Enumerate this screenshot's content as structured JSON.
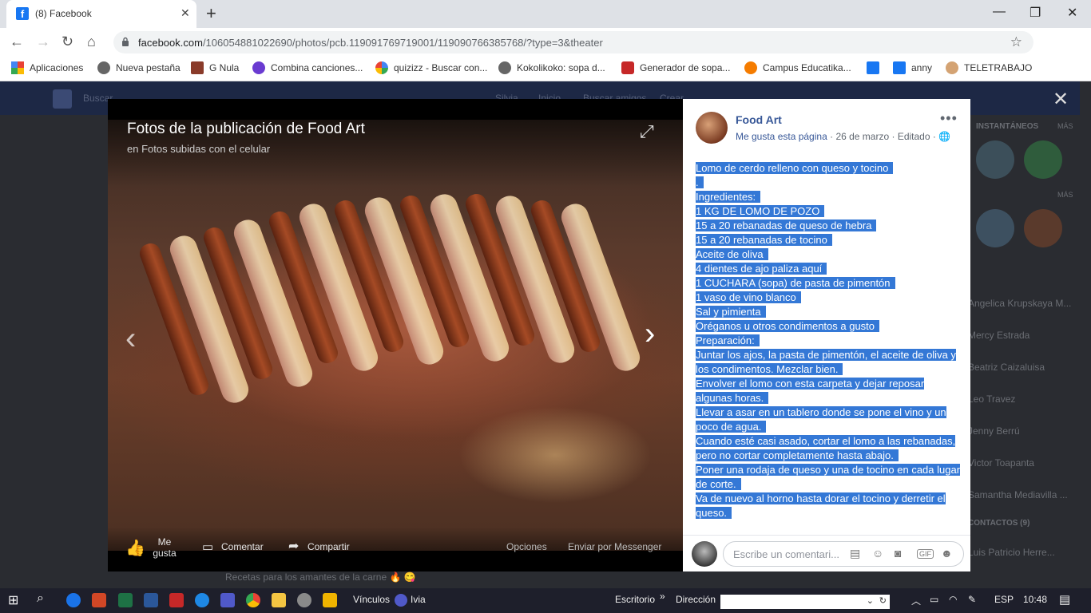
{
  "browser": {
    "tab_title": "(8) Facebook",
    "tab_icon": "facebook-icon",
    "url_domain": "facebook.com",
    "url_path": "/106054881022690/photos/pcb.119091769719001/119090766385768/?type=3&theater"
  },
  "bookmarks": [
    {
      "label": "Aplicaciones",
      "icon": "apps-grid-icon",
      "color": "#e94235"
    },
    {
      "label": "Nueva pestaña",
      "icon": "globe-icon",
      "color": "#555555"
    },
    {
      "label": "G Nula",
      "icon": "image-icon",
      "color": "#8a3b2a"
    },
    {
      "label": "Combina canciones...",
      "icon": "music-icon",
      "color": "#6a3bd1"
    },
    {
      "label": "quizizz - Buscar con...",
      "icon": "google-icon",
      "color": "#4285f4"
    },
    {
      "label": "Kokolikoko: sopa d...",
      "icon": "globe-icon",
      "color": "#555555"
    },
    {
      "label": "Generador de sopa...",
      "icon": "eraser-icon",
      "color": "#c62828"
    },
    {
      "label": "Campus Educatika...",
      "icon": "campus-icon",
      "color": "#f57c00"
    },
    {
      "label": "",
      "icon": "facebook-icon",
      "color": "#1877f2"
    },
    {
      "label": "anny",
      "icon": "facebook-icon",
      "color": "#1877f2"
    },
    {
      "label": "TELETRABAJO",
      "icon": "worker-icon",
      "color": "#d4a373"
    }
  ],
  "background": {
    "search_placeholder": "Buscar",
    "nav_items": [
      "Silvia",
      "Inicio",
      "Buscar amigos",
      "Crear"
    ],
    "sidebar_headers": [
      "INSTANTÁNEOS",
      "MÁS",
      "MÁS",
      "CONTACTOS (9)"
    ],
    "contacts": [
      "Angelica Krupskaya M...",
      "Mercy Estrada",
      "Beatriz Caizaluisa",
      "Leo Travez",
      "Jenny Berrú",
      "Victor Toapanta",
      "Samantha Mediavilla ...",
      "Luis Patricio Herre..."
    ],
    "feed_text": "Recetas para los amantes de la carne 🔥 😋"
  },
  "photo": {
    "title": "Fotos de la publicación de Food Art",
    "subtitle": "en Fotos subidas con el celular",
    "like_label": "Me gusta",
    "comment_label": "Comentar",
    "share_label": "Compartir",
    "options_label": "Opciones",
    "messenger_label": "Enviar por Messenger"
  },
  "post": {
    "page_name": "Food Art",
    "like_page": "Me gusta esta página",
    "date": "26 de marzo",
    "edited": "Editado",
    "lines": [
      "Lomo de cerdo relleno con queso y tocino",
      ".",
      "Ingredientes:",
      "1 KG DE LOMO DE POZO",
      "15 a 20 rebanadas de queso de hebra",
      "15 a 20 rebanadas de tocino",
      "Aceite de oliva",
      "4 dientes de ajo paliza aquí",
      "1 CUCHARA (sopa) de pasta de pimentón",
      "1 vaso de vino blanco",
      "Sal y pimienta",
      "Oréganos u otros condimentos a gusto",
      "Preparación:",
      "Juntar los ajos, la pasta de pimentón, el aceite de oliva y los condimentos. Mezclar bien.",
      "Envolver el lomo con esta carpeta y dejar reposar algunas horas.",
      "Llevar a asar en un tablero donde se pone el vino y un poco de agua.",
      "Cuando esté casi asado, cortar el lomo a las rebanadas, pero no cortar completamente hasta abajo.",
      "Poner una rodaja de queso y una de tocino en cada lugar de corte.",
      "Va de nuevo al horno hasta dorar el tocino y derretir el queso."
    ],
    "comment_placeholder": "Escribe un comentari..."
  },
  "taskbar": {
    "vinculos": "Vínculos",
    "ivia": "Ivia",
    "escritorio": "Escritorio",
    "direccion": "Dirección",
    "lang": "ESP",
    "time": "10:48"
  }
}
